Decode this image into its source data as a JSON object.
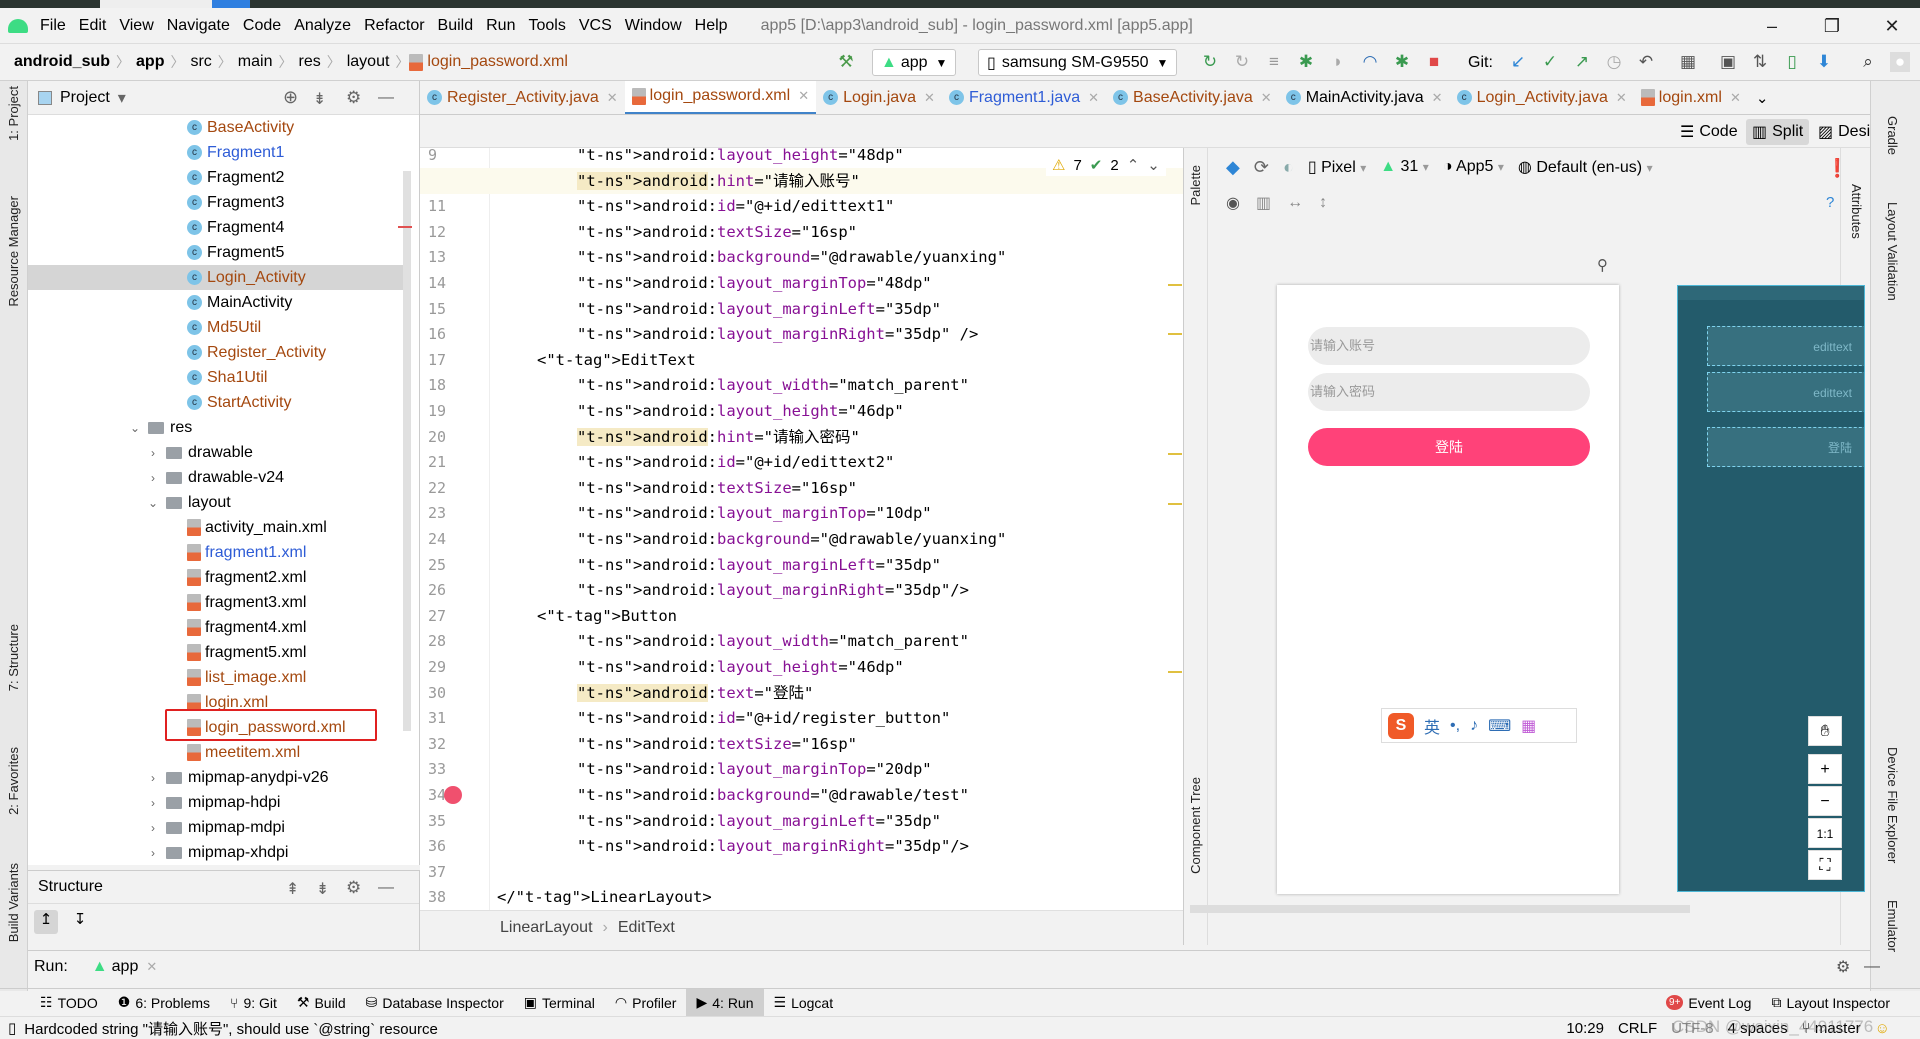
{
  "window": {
    "title": "app5 [D:\\app3\\android_sub] - login_password.xml [app5.app]",
    "minimize": "–",
    "maximize": "❐",
    "close": "✕"
  },
  "menu": [
    "File",
    "Edit",
    "View",
    "Navigate",
    "Code",
    "Analyze",
    "Refactor",
    "Build",
    "Run",
    "Tools",
    "VCS",
    "Window",
    "Help"
  ],
  "breadcrumb": [
    "android_sub",
    "app",
    "src",
    "main",
    "res",
    "layout",
    "login_password.xml"
  ],
  "toolbar": {
    "run_config": "app",
    "device": "samsung SM-G9550",
    "git_label": "Git:"
  },
  "project": {
    "title": "Project",
    "view_dropdown": "▾",
    "items": [
      {
        "label": "BaseActivity",
        "type": "class",
        "level": 3,
        "color": "brown"
      },
      {
        "label": "Fragment1",
        "type": "class",
        "level": 3,
        "color": "blue"
      },
      {
        "label": "Fragment2",
        "type": "class",
        "level": 3,
        "color": "black"
      },
      {
        "label": "Fragment3",
        "type": "class",
        "level": 3,
        "color": "black"
      },
      {
        "label": "Fragment4",
        "type": "class",
        "level": 3,
        "color": "black"
      },
      {
        "label": "Fragment5",
        "type": "class",
        "level": 3,
        "color": "black"
      },
      {
        "label": "Login_Activity",
        "type": "class",
        "level": 3,
        "color": "brown",
        "selected": true
      },
      {
        "label": "MainActivity",
        "type": "class",
        "level": 3,
        "color": "black"
      },
      {
        "label": "Md5Util",
        "type": "class",
        "level": 3,
        "color": "brown"
      },
      {
        "label": "Register_Activity",
        "type": "class",
        "level": 3,
        "color": "brown"
      },
      {
        "label": "Sha1Util",
        "type": "class",
        "level": 3,
        "color": "brown"
      },
      {
        "label": "StartActivity",
        "type": "class",
        "level": 3,
        "color": "brown"
      },
      {
        "label": "res",
        "type": "folder",
        "level": 1,
        "expanded": true,
        "color": "black"
      },
      {
        "label": "drawable",
        "type": "folder",
        "level": 2,
        "expanded": false,
        "color": "black"
      },
      {
        "label": "drawable-v24",
        "type": "folder",
        "level": 2,
        "expanded": false,
        "color": "black"
      },
      {
        "label": "layout",
        "type": "folder",
        "level": 2,
        "expanded": true,
        "color": "black"
      },
      {
        "label": "activity_main.xml",
        "type": "xml",
        "level": 3,
        "color": "black"
      },
      {
        "label": "fragment1.xml",
        "type": "xml",
        "level": 3,
        "color": "blue"
      },
      {
        "label": "fragment2.xml",
        "type": "xml",
        "level": 3,
        "color": "black"
      },
      {
        "label": "fragment3.xml",
        "type": "xml",
        "level": 3,
        "color": "black"
      },
      {
        "label": "fragment4.xml",
        "type": "xml",
        "level": 3,
        "color": "black"
      },
      {
        "label": "fragment5.xml",
        "type": "xml",
        "level": 3,
        "color": "black"
      },
      {
        "label": "list_image.xml",
        "type": "xml",
        "level": 3,
        "color": "brown"
      },
      {
        "label": "login.xml",
        "type": "xml",
        "level": 3,
        "color": "brown"
      },
      {
        "label": "login_password.xml",
        "type": "xml",
        "level": 3,
        "color": "brown",
        "highlighted": true
      },
      {
        "label": "meetitem.xml",
        "type": "xml",
        "level": 3,
        "color": "brown"
      },
      {
        "label": "mipmap-anydpi-v26",
        "type": "folder",
        "level": 2,
        "expanded": false,
        "color": "black"
      },
      {
        "label": "mipmap-hdpi",
        "type": "folder",
        "level": 2,
        "expanded": false,
        "color": "black"
      },
      {
        "label": "mipmap-mdpi",
        "type": "folder",
        "level": 2,
        "expanded": false,
        "color": "black"
      },
      {
        "label": "mipmap-xhdpi",
        "type": "folder",
        "level": 2,
        "expanded": false,
        "color": "black"
      }
    ]
  },
  "structure": {
    "title": "Structure"
  },
  "tabs": [
    {
      "label": "Register_Activity.java",
      "type": "class",
      "color": "brown"
    },
    {
      "label": "login_password.xml",
      "type": "xml",
      "color": "brown",
      "active": true
    },
    {
      "label": "Login.java",
      "type": "class",
      "color": "brown"
    },
    {
      "label": "Fragment1.java",
      "type": "class",
      "color": "blue"
    },
    {
      "label": "BaseActivity.java",
      "type": "class",
      "color": "brown"
    },
    {
      "label": "MainActivity.java",
      "type": "class",
      "color": "black"
    },
    {
      "label": "Login_Activity.java",
      "type": "class",
      "color": "brown"
    },
    {
      "label": "login.xml",
      "type": "xml",
      "color": "brown"
    }
  ],
  "view_modes": {
    "code": "Code",
    "split": "Split",
    "design": "Design",
    "active": "Split"
  },
  "inspections": {
    "warnings": "7",
    "typos": "2"
  },
  "code": [
    {
      "n": 9,
      "indent": 2,
      "text": "android:layout_height=\"48dp\""
    },
    {
      "n": 10,
      "indent": 2,
      "text": "android:hint=\"请输入账号\"",
      "current": true,
      "hl": true
    },
    {
      "n": 11,
      "indent": 2,
      "text": "android:id=\"@+id/edittext1\""
    },
    {
      "n": 12,
      "indent": 2,
      "text": "android:textSize=\"16sp\""
    },
    {
      "n": 13,
      "indent": 2,
      "text": "android:background=\"@drawable/yuanxing\""
    },
    {
      "n": 14,
      "indent": 2,
      "text": "android:layout_marginTop=\"48dp\""
    },
    {
      "n": 15,
      "indent": 2,
      "text": "android:layout_marginLeft=\"35dp\""
    },
    {
      "n": 16,
      "indent": 2,
      "text": "android:layout_marginRight=\"35dp\" />"
    },
    {
      "n": 17,
      "indent": 1,
      "text": "<EditText"
    },
    {
      "n": 18,
      "indent": 2,
      "text": "android:layout_width=\"match_parent\""
    },
    {
      "n": 19,
      "indent": 2,
      "text": "android:layout_height=\"46dp\""
    },
    {
      "n": 20,
      "indent": 2,
      "text": "android:hint=\"请输入密码\"",
      "hl": true
    },
    {
      "n": 21,
      "indent": 2,
      "text": "android:id=\"@+id/edittext2\""
    },
    {
      "n": 22,
      "indent": 2,
      "text": "android:textSize=\"16sp\""
    },
    {
      "n": 23,
      "indent": 2,
      "text": "android:layout_marginTop=\"10dp\""
    },
    {
      "n": 24,
      "indent": 2,
      "text": "android:background=\"@drawable/yuanxing\""
    },
    {
      "n": 25,
      "indent": 2,
      "text": "android:layout_marginLeft=\"35dp\""
    },
    {
      "n": 26,
      "indent": 2,
      "text": "android:layout_marginRight=\"35dp\"/>"
    },
    {
      "n": 27,
      "indent": 1,
      "text": "<Button"
    },
    {
      "n": 28,
      "indent": 2,
      "text": "android:layout_width=\"match_parent\""
    },
    {
      "n": 29,
      "indent": 2,
      "text": "android:layout_height=\"46dp\""
    },
    {
      "n": 30,
      "indent": 2,
      "text": "android:text=\"登陆\"",
      "hl": true
    },
    {
      "n": 31,
      "indent": 2,
      "text": "android:id=\"@+id/register_button\""
    },
    {
      "n": 32,
      "indent": 2,
      "text": "android:textSize=\"16sp\""
    },
    {
      "n": 33,
      "indent": 2,
      "text": "android:layout_marginTop=\"20dp\""
    },
    {
      "n": 34,
      "indent": 2,
      "text": "android:background=\"@drawable/test\"",
      "breakpoint": true
    },
    {
      "n": 35,
      "indent": 2,
      "text": "android:layout_marginLeft=\"35dp\""
    },
    {
      "n": 36,
      "indent": 2,
      "text": "android:layout_marginRight=\"35dp\"/>"
    },
    {
      "n": 37,
      "indent": 2,
      "text": ""
    },
    {
      "n": 38,
      "indent": 0,
      "text": "</LinearLayout>"
    }
  ],
  "editor_breadcrumb": [
    "LinearLayout",
    "EditText"
  ],
  "design": {
    "device": "Pixel",
    "api": "31",
    "theme": "App5",
    "locale": "Default (en-us)",
    "preview": {
      "field1_hint": "请输入账号",
      "field2_hint": "请输入密码",
      "button": "登陆"
    },
    "blueprint": {
      "field1": "edittext",
      "field2": "edittext",
      "button": "登陆"
    },
    "zoom": {
      "in": "+",
      "out": "−",
      "fit": "1:1"
    }
  },
  "palette_label": "Palette",
  "component_tree_label": "Component Tree",
  "attributes_label": "Attributes",
  "ime": {
    "lang": "英",
    "punct": "•,"
  },
  "left_stripe": [
    "1: Project",
    "Resource Manager",
    "7: Structure",
    "2: Favorites",
    "Build Variants"
  ],
  "right_stripe": [
    "Gradle",
    "Layout Validation",
    "Device File Explorer",
    "Emulator"
  ],
  "run": {
    "label": "Run:",
    "config": "app"
  },
  "tool_windows": [
    "TODO",
    "6: Problems",
    "9: Git",
    "Build",
    "Database Inspector",
    "Terminal",
    "Profiler",
    "4: Run",
    "Logcat"
  ],
  "tool_windows_right": [
    "Event Log",
    "Layout Inspector"
  ],
  "status": {
    "message": "Hardcoded string \"请输入账号\", should use `@string` resource",
    "position": "10:29",
    "line_sep": "CRLF",
    "encoding": "UTF-8",
    "indent": "4 spaces",
    "branch": "master"
  },
  "watermark": "CSDN @weixin_44911776",
  "colors": {
    "accent": "#4083c9",
    "button_pink": "#ff4279",
    "blueprint": "#235b6b",
    "breakpoint": "#f0506e",
    "highlight_box": "#e02020"
  }
}
